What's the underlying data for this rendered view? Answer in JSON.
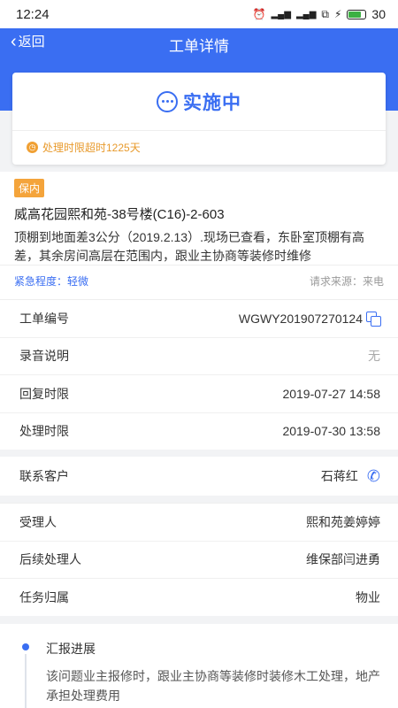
{
  "status_bar": {
    "time": "12:24",
    "battery": "30"
  },
  "header": {
    "back_label": "返回",
    "title": "工单详情"
  },
  "status_card": {
    "status": "实施中",
    "warning": "处理时限超时1225天"
  },
  "info": {
    "tag": "保内",
    "address": "威高花园熙和苑-38号楼(C16)-2-603",
    "description": "顶棚到地面差3公分（2019.2.13）.现场已查看，东卧室顶棚有高差，其余房间高层在范围内，跟业主协商等装修时维修",
    "urgency": "紧急程度：轻微",
    "source": "请求来源：来电"
  },
  "rows": [
    {
      "label": "工单编号",
      "value": "WGWY201907270124"
    },
    {
      "label": "录音说明",
      "value": "无"
    },
    {
      "label": "回复时限",
      "value": "2019-07-27 14:58"
    },
    {
      "label": "处理时限",
      "value": "2019-07-30 13:58"
    }
  ],
  "contact": {
    "label": "联系客户",
    "value": "石蒋红"
  },
  "assign": [
    {
      "label": "受理人",
      "value": "熙和苑姜婷婷"
    },
    {
      "label": "后续处理人",
      "value": "维保部闫进勇"
    },
    {
      "label": "任务归属",
      "value": "物业"
    }
  ],
  "progress": {
    "title": "汇报进展",
    "text": "该问题业主报修时，跟业主协商等装修时装修木工处理，地产承担处理费用"
  },
  "colors": {
    "accent": "#3a6ef2",
    "warn": "#f0a033"
  }
}
